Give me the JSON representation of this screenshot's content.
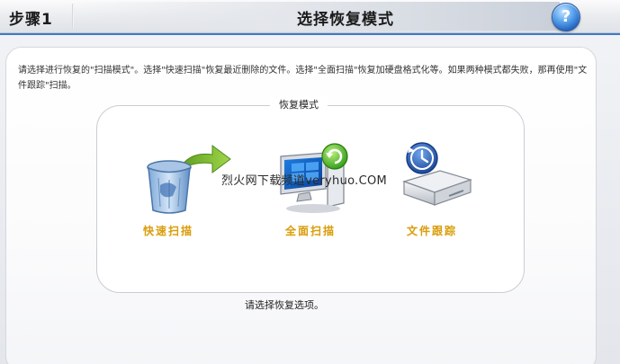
{
  "header": {
    "step": "步骤1",
    "title": "选择恢复模式",
    "help_symbol": "?"
  },
  "instructions": "请选择进行恢复的\"扫描模式\"。选择\"快速扫描\"恢复最近删除的文件。选择\"全面扫描\"恢复加硬盘格式化等。如果两种模式都失败，那再使用\"文件跟踪\"扫描。",
  "mode_group": {
    "title": "恢复模式",
    "options": [
      {
        "label": "快速扫描",
        "icon": "recycle-bin-icon"
      },
      {
        "label": "全面扫描",
        "icon": "computer-refresh-icon"
      },
      {
        "label": "文件跟踪",
        "icon": "hard-drive-clock-icon"
      }
    ]
  },
  "watermark": "烈火网下载频道veryhuo.COM",
  "prompt": "请选择恢复选项。",
  "colors": {
    "accent_line": "#3d79c9",
    "option_label": "#d89d12",
    "help_button": "#1f5cb8"
  }
}
